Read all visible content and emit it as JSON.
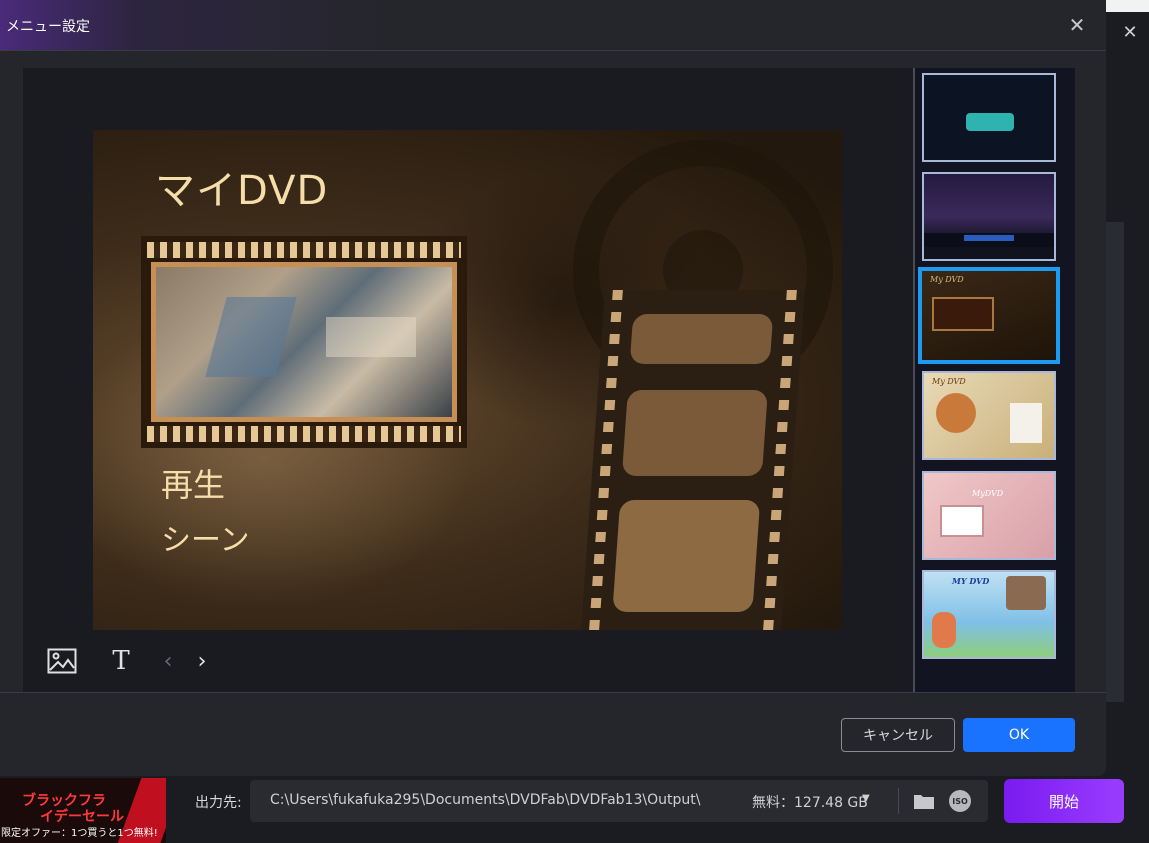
{
  "dialog": {
    "title": "メニュー設定",
    "close_icon": "close-icon",
    "cancel_label": "キャンセル",
    "ok_label": "OK"
  },
  "menu_preview": {
    "title": "マイDVD",
    "items": [
      "再生",
      "シーン"
    ]
  },
  "toolbar": {
    "icons": [
      "image-icon",
      "text-icon",
      "chevron-left-icon",
      "chevron-right-icon"
    ],
    "text_glyph": "T",
    "prev_glyph": "‹",
    "next_glyph": "›"
  },
  "templates": {
    "selected_index": 2,
    "thumb_labels": [
      "",
      "",
      "My DVD",
      "My DVD",
      "MyDVD",
      "MY DVD"
    ]
  },
  "bottom_bar": {
    "promo_line1": "ブラックフラ",
    "promo_line2": "イデーセール",
    "promo_line3": "限定オファー：1つ買うと1つ無料!",
    "output_label": "出力先:",
    "output_path": "C:\\Users\\fukafuka295\\Documents\\DVDFab\\DVDFab13\\Output\\",
    "free_space": "無料：127.48 GB",
    "iso_label": "ISO",
    "start_label": "開始"
  },
  "colors": {
    "accent": "#1a73ff",
    "start_button": "#8a2cff",
    "selected_border": "#1d9bf0"
  }
}
